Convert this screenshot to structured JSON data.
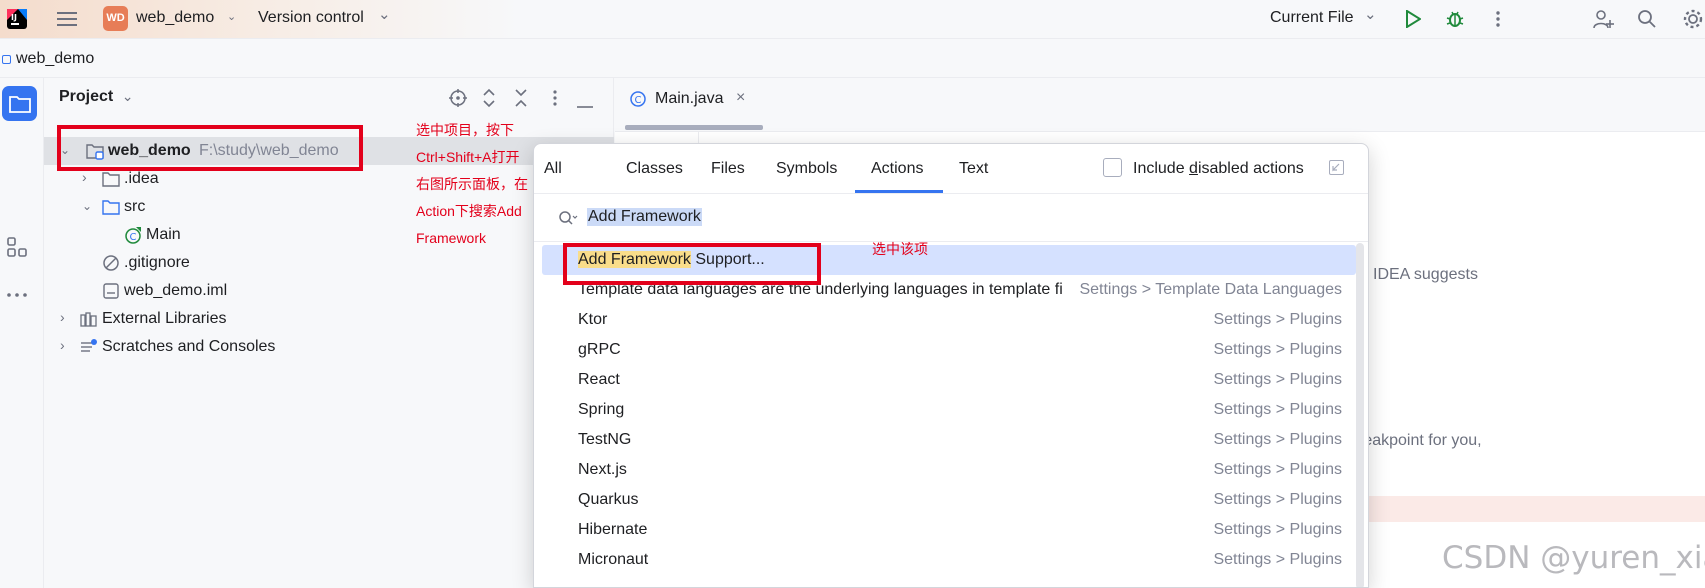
{
  "titlebar": {
    "project_badge": "WD",
    "project_name": "web_demo",
    "vcs_label": "Version control",
    "run_config": "Current File"
  },
  "breadcrumb": {
    "label": "web_demo"
  },
  "project_panel": {
    "title": "Project",
    "tree": {
      "root_name": "web_demo",
      "root_path": "F:\\study\\web_demo",
      "idea": ".idea",
      "src": "src",
      "main": "Main",
      "gitignore": ".gitignore",
      "iml": "web_demo.iml",
      "ext_libs": "External Libraries",
      "scratches": "Scratches and Consoles"
    }
  },
  "editor": {
    "tab_label": "Main.java",
    "partial_text_1": "IDEA suggests",
    "partial_text_2": "reakpoint for you,"
  },
  "popup": {
    "tabs": [
      "All",
      "Classes",
      "Files",
      "Symbols",
      "Actions",
      "Text"
    ],
    "active_tab": "Actions",
    "include_disabled_pre": "Include ",
    "include_disabled_mnemonic": "d",
    "include_disabled_post": "isabled actions",
    "search_value": "Add Framework",
    "first_result_match": "Add Framework",
    "first_result_rest": " Support...",
    "results": [
      {
        "name": "Template data languages are the underlying languages in template fi",
        "location": "Settings > Template Data Languages"
      },
      {
        "name": "Ktor",
        "location": "Settings > Plugins"
      },
      {
        "name": "gRPC",
        "location": "Settings > Plugins"
      },
      {
        "name": "React",
        "location": "Settings > Plugins"
      },
      {
        "name": "Spring",
        "location": "Settings > Plugins"
      },
      {
        "name": "TestNG",
        "location": "Settings > Plugins"
      },
      {
        "name": "Next.js",
        "location": "Settings > Plugins"
      },
      {
        "name": "Quarkus",
        "location": "Settings > Plugins"
      },
      {
        "name": "Hibernate",
        "location": "Settings > Plugins"
      },
      {
        "name": "Micronaut",
        "location": "Settings > Plugins"
      }
    ]
  },
  "annotations": {
    "instruction_lines": [
      "选中项目，按下",
      "Ctrl+Shift+A打开",
      "右图所示面板，在",
      "Action下搜索Add",
      "Framework"
    ],
    "select_note": "选中该项"
  },
  "watermark": "CSDN @yuren_xia",
  "colors": {
    "accent": "#3574f0",
    "annotation_red": "#e3001b",
    "selection": "#d5e1ff",
    "match_highlight": "#f9dd8a",
    "run_green": "#208a3c"
  }
}
